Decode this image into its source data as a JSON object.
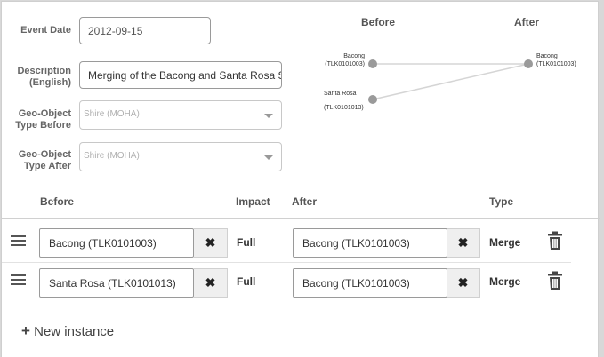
{
  "form": {
    "event_date_label": "Event Date",
    "event_date_value": "2012-09-15",
    "description_label": "Description (English)",
    "description_value": "Merging of the Bacong and Santa Rosa Sh",
    "type_before_label": "Geo-Object Type Before",
    "type_before_value": "Shire (MOHA)",
    "type_after_label": "Geo-Object Type After",
    "type_after_value": "Shire (MOHA)"
  },
  "graph": {
    "before_header": "Before",
    "after_header": "After",
    "before_nodes": [
      {
        "name": "Bacong",
        "code": "(TLK0101003)"
      },
      {
        "name": "Santa Rosa",
        "code": "(TLK0101013)"
      }
    ],
    "after_nodes": [
      {
        "name": "Bacong",
        "code": "(TLK0101003)"
      }
    ]
  },
  "table": {
    "headers": {
      "before": "Before",
      "impact": "Impact",
      "after": "After",
      "type": "Type"
    },
    "rows": [
      {
        "before": "Bacong (TLK0101003)",
        "impact": "Full",
        "after": "Bacong (TLK0101003)",
        "type": "Merge"
      },
      {
        "before": "Santa Rosa (TLK0101013)",
        "impact": "Full",
        "after": "Bacong (TLK0101003)",
        "type": "Merge"
      }
    ],
    "clear_symbol": "✖",
    "new_instance_icon": "+",
    "new_instance_label": "New instance"
  }
}
